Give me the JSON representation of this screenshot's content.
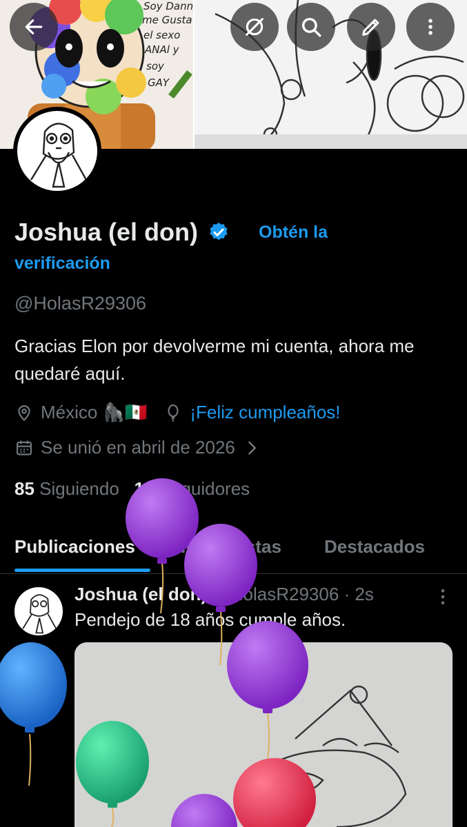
{
  "banner": {
    "drawing_text": [
      "Soy Danny",
      "me Gusta",
      "el sexo",
      "ANAl y",
      "soy",
      "GAY"
    ]
  },
  "toolbar": {
    "back_icon": "arrow-left-icon",
    "no_sync_icon": "no-sync-icon",
    "search_icon": "search-icon",
    "edit_icon": "pen-icon",
    "more_icon": "more-vertical-icon"
  },
  "profile": {
    "display_name": "Joshua (el don)",
    "verify_cta_line1": "Obtén la",
    "verify_cta_line2": "verificación",
    "handle": "@HolasR29306",
    "bio": "Gracias Elon por devolverme mi cuenta, ahora me quedaré aquí.",
    "location": "México 🦍🇲🇽",
    "birthday": "¡Feliz cumpleaños!",
    "joined": "Se unió en abril de 2026",
    "following_count": "85",
    "following_label": "Siguiendo",
    "followers_count": "18",
    "followers_label": "Seguidores"
  },
  "tabs": [
    {
      "label": "Publicaciones",
      "active": true
    },
    {
      "label": "Respuestas",
      "active": false
    },
    {
      "label": "Destacados",
      "active": false
    }
  ],
  "post": {
    "author": "Joshua (el don)",
    "handle": "@HolasR29306",
    "time": "· 2s",
    "text": "Pendejo de 18 años cumple años."
  },
  "colors": {
    "accent": "#1d9bf0",
    "background": "#000000",
    "secondary_text": "#71767b",
    "balloon_purple": "#9b3fd6",
    "balloon_blue": "#2e86de",
    "balloon_green": "#2ecc8f",
    "balloon_red": "#e8415a"
  }
}
